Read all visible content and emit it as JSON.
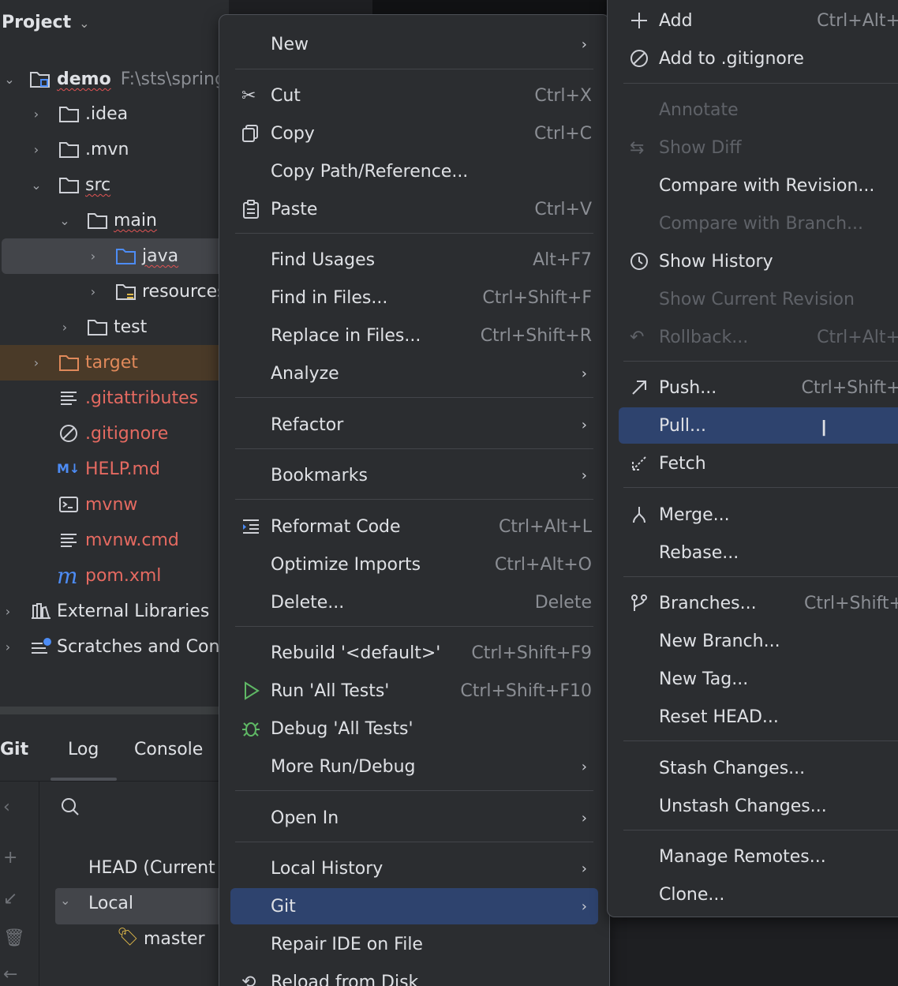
{
  "project": {
    "title": "Project",
    "root_name": "demo",
    "root_path": "F:\\sts\\spring",
    "items": [
      {
        "label": ".idea"
      },
      {
        "label": ".mvn"
      },
      {
        "label": "src"
      },
      {
        "label": "main"
      },
      {
        "label": "java"
      },
      {
        "label": "resources"
      },
      {
        "label": "test"
      },
      {
        "label": "target"
      },
      {
        "label": ".gitattributes"
      },
      {
        "label": ".gitignore"
      },
      {
        "label": "HELP.md"
      },
      {
        "label": "mvnw"
      },
      {
        "label": "mvnw.cmd"
      },
      {
        "label": "pom.xml"
      },
      {
        "label": "External Libraries"
      },
      {
        "label": "Scratches and Cons"
      }
    ]
  },
  "git_panel": {
    "tabs": [
      "Git",
      "Log",
      "Console"
    ],
    "head_label": "HEAD (Current b",
    "local_label": "Local",
    "branch_label": "master"
  },
  "context_menu": {
    "items": [
      {
        "label": "New",
        "shortcut": ""
      },
      {
        "label": "Cut",
        "shortcut": "Ctrl+X"
      },
      {
        "label": "Copy",
        "shortcut": "Ctrl+C"
      },
      {
        "label": "Copy Path/Reference...",
        "shortcut": ""
      },
      {
        "label": "Paste",
        "shortcut": "Ctrl+V"
      },
      {
        "label": "Find Usages",
        "shortcut": "Alt+F7"
      },
      {
        "label": "Find in Files...",
        "shortcut": "Ctrl+Shift+F"
      },
      {
        "label": "Replace in Files...",
        "shortcut": "Ctrl+Shift+R"
      },
      {
        "label": "Analyze",
        "shortcut": ""
      },
      {
        "label": "Refactor",
        "shortcut": ""
      },
      {
        "label": "Bookmarks",
        "shortcut": ""
      },
      {
        "label": "Reformat Code",
        "shortcut": "Ctrl+Alt+L"
      },
      {
        "label": "Optimize Imports",
        "shortcut": "Ctrl+Alt+O"
      },
      {
        "label": "Delete...",
        "shortcut": "Delete"
      },
      {
        "label": "Rebuild '<default>'",
        "shortcut": "Ctrl+Shift+F9"
      },
      {
        "label": "Run 'All Tests'",
        "shortcut": "Ctrl+Shift+F10"
      },
      {
        "label": "Debug 'All Tests'",
        "shortcut": ""
      },
      {
        "label": "More Run/Debug",
        "shortcut": ""
      },
      {
        "label": "Open In",
        "shortcut": ""
      },
      {
        "label": "Local History",
        "shortcut": ""
      },
      {
        "label": "Git",
        "shortcut": ""
      },
      {
        "label": "Repair IDE on File",
        "shortcut": ""
      },
      {
        "label": "Reload from Disk",
        "shortcut": ""
      }
    ]
  },
  "git_menu": {
    "items": [
      {
        "label": "Add",
        "shortcut": "Ctrl+Alt+A"
      },
      {
        "label": "Add to .gitignore",
        "shortcut": ""
      },
      {
        "label": "Annotate",
        "shortcut": ""
      },
      {
        "label": "Show Diff",
        "shortcut": ""
      },
      {
        "label": "Compare with Revision...",
        "shortcut": ""
      },
      {
        "label": "Compare with Branch...",
        "shortcut": ""
      },
      {
        "label": "Show History",
        "shortcut": ""
      },
      {
        "label": "Show Current Revision",
        "shortcut": ""
      },
      {
        "label": "Rollback...",
        "shortcut": "Ctrl+Alt+Z"
      },
      {
        "label": "Push...",
        "shortcut": "Ctrl+Shift+K"
      },
      {
        "label": "Pull...",
        "shortcut": ""
      },
      {
        "label": "Fetch",
        "shortcut": ""
      },
      {
        "label": "Merge...",
        "shortcut": ""
      },
      {
        "label": "Rebase...",
        "shortcut": ""
      },
      {
        "label": "Branches...",
        "shortcut": "Ctrl+Shift+`"
      },
      {
        "label": "New Branch...",
        "shortcut": ""
      },
      {
        "label": "New Tag...",
        "shortcut": ""
      },
      {
        "label": "Reset HEAD...",
        "shortcut": ""
      },
      {
        "label": "Stash Changes...",
        "shortcut": ""
      },
      {
        "label": "Unstash Changes...",
        "shortcut": ""
      },
      {
        "label": "Manage Remotes...",
        "shortcut": ""
      },
      {
        "label": "Clone...",
        "shortcut": ""
      }
    ]
  },
  "colors": {
    "background": "#1e1f22",
    "panel": "#2b2d30",
    "highlight": "#2e436e",
    "ignored_text": "#e56a61",
    "excluded_text": "#e0895a"
  }
}
